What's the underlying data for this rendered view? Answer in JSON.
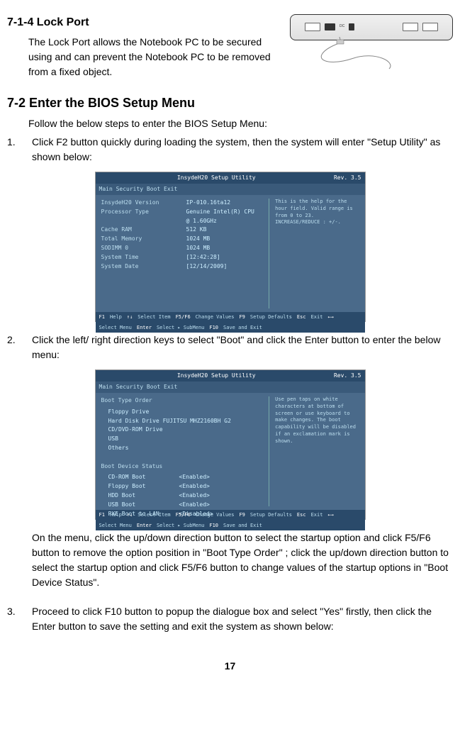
{
  "section1": {
    "heading": "7-1-4 Lock Port",
    "body": "The Lock Port allows the Notebook PC to be secured using and can prevent the Notebook PC to be removed from a fixed object."
  },
  "section2": {
    "heading": "7-2 Enter the BIOS Setup Menu",
    "intro": "Follow the below steps to enter the BIOS Setup Menu:",
    "step1_num": "1.",
    "step1": "Click F2 button quickly during loading the system, then the system will enter \"Setup Utility\" as shown below:",
    "step2_num": "2.",
    "step2": "Click the left/ right direction keys to select \"Boot\" and click the Enter button to enter the below menu:",
    "step2_after": "On the menu, click the up/down direction button to select the startup option and click F5/F6 button to remove the option position in \"Boot Type Order\" ; click the up/down direction button to select the startup option and click F5/F6 button to change values of the startup options in \"Boot Device Status\".",
    "step3_num": "3.",
    "step3": "Proceed to click F10 button to popup the dialogue box and select \"Yes\" firstly, then click the Enter button to save the setting and exit the system as shown below:"
  },
  "bios1": {
    "title": "InsydeH20 Setup Utility",
    "rev": "Rev. 3.5",
    "tabs": "Main  Security  Boot  Exit",
    "rows": [
      [
        "InsydeH20 Version",
        "IP-010.16ta12"
      ],
      [
        "Processor Type",
        "Genuine Intel(R) CPU"
      ],
      [
        "",
        "@ 1.60GHz"
      ],
      [
        "",
        ""
      ],
      [
        "Cache RAM",
        "512 KB"
      ],
      [
        "",
        ""
      ],
      [
        "Total Memory",
        "1024 MB"
      ],
      [
        "SODIMM 0",
        "1024 MB"
      ],
      [
        "",
        ""
      ],
      [
        "",
        ""
      ],
      [
        "System Time",
        "[12:42:28]"
      ],
      [
        "System Date",
        "[12/14/2009]"
      ]
    ],
    "help": "This is the help for the hour field. Valid range is from 0 to 23. INCREASE/REDUCE : +/-.",
    "footer": [
      "F1",
      "Help",
      "↑↓",
      "Select Item",
      "F5/F6",
      "Change Values",
      "F9",
      "Setup Defaults",
      "Esc",
      "Exit",
      "←→",
      "Select Menu",
      "Enter",
      "Select ▸ SubMenu",
      "F10",
      "Save and Exit"
    ]
  },
  "bios2": {
    "title": "InsydeH20 Setup Utility",
    "rev": "Rev. 3.5",
    "tabs": "Main  Security  Boot  Exit",
    "section1_title": "Boot Type Order",
    "section1_items": [
      "Floppy Drive",
      "Hard Disk Drive  FUJITSU MHZ2160BH G2",
      "CD/DVD-ROM Drive",
      "USB",
      "Others"
    ],
    "section2_title": "Boot Device Status",
    "section2_items": [
      [
        "CD-ROM Boot",
        "<Enabled>"
      ],
      [
        "Floppy Boot",
        "<Enabled>"
      ],
      [
        "HDD Boot",
        "<Enabled>"
      ],
      [
        "USB Boot",
        "<Enabled>"
      ],
      [
        "PXE Boot to LAN",
        "<Disabled>"
      ]
    ],
    "help": "Use pen taps on white characters at bottom of screen or use keyboard to make changes. The boot capability will be disabled if an exclamation mark is shown.",
    "footer": [
      "F1",
      "Help",
      "↑↓",
      "Select Item",
      "F5/F6",
      "Change Values",
      "F9",
      "Setup Defaults",
      "Esc",
      "Exit",
      "←→",
      "Select Menu",
      "Enter",
      "Select ▸ SubMenu",
      "F10",
      "Save and Exit"
    ]
  },
  "page_number": "17"
}
